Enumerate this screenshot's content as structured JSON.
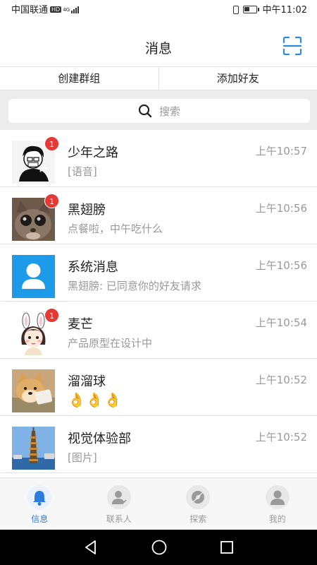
{
  "status_bar": {
    "carrier": "中国联通",
    "hd": "HD",
    "network": "4G",
    "time": "中午11:02"
  },
  "header": {
    "title": "消息"
  },
  "actions": {
    "create_group": "创建群组",
    "add_friend": "添加好友"
  },
  "search": {
    "placeholder": "搜索"
  },
  "conversations": [
    {
      "name": "少年之路",
      "preview": "[语音]",
      "time": "上午10:57",
      "badge": "1",
      "avatar": "sketch-boy-avatar"
    },
    {
      "name": "黑翅膀",
      "preview": "点餐啦，中午吃什么",
      "time": "上午10:56",
      "badge": "1",
      "avatar": "cat-photo-avatar"
    },
    {
      "name": "系统消息",
      "preview": "黑翅膀: 已同意你的好友请求",
      "time": "上午10:56",
      "badge": "",
      "avatar": "system-user-avatar"
    },
    {
      "name": "麦芒",
      "preview": "产品原型在设计中",
      "time": "上午10:54",
      "badge": "1",
      "avatar": "bunny-girl-avatar"
    },
    {
      "name": "溜溜球",
      "preview": "👌👌👌",
      "time": "上午10:52",
      "badge": "",
      "avatar": "shiba-dog-avatar"
    },
    {
      "name": "视觉体验部",
      "preview": "[图片]",
      "time": "上午10:52",
      "badge": "",
      "avatar": "tower-photo-avatar"
    }
  ],
  "tabs": [
    {
      "label": "信息",
      "icon": "bell-icon",
      "active": true
    },
    {
      "label": "联系人",
      "icon": "contacts-icon",
      "active": false
    },
    {
      "label": "探索",
      "icon": "explore-icon",
      "active": false
    },
    {
      "label": "我的",
      "icon": "profile-icon",
      "active": false
    }
  ],
  "colors": {
    "accent": "#2d7ce0",
    "badge": "#e53935",
    "system_avatar": "#1e9be8"
  }
}
